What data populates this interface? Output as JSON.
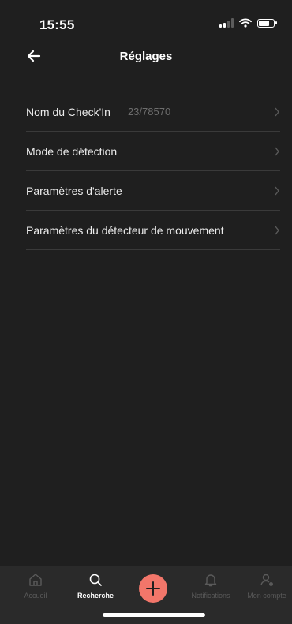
{
  "status_bar": {
    "time": "15:55"
  },
  "header": {
    "title": "Réglages"
  },
  "settings": {
    "items": [
      {
        "label": "Nom du Check'In",
        "value": "23/78570"
      },
      {
        "label": "Mode de détection"
      },
      {
        "label": "Paramètres d'alerte"
      },
      {
        "label": "Paramètres du détecteur de mouvement"
      }
    ]
  },
  "tab_bar": {
    "tabs": [
      {
        "label": "Accueil",
        "icon": "home-icon",
        "active": false
      },
      {
        "label": "Recherche",
        "icon": "search-icon",
        "active": true
      },
      {
        "label": "Notifications",
        "icon": "bell-icon",
        "active": false
      },
      {
        "label": "Mon compte",
        "icon": "user-icon",
        "active": false
      }
    ],
    "add_icon": "plus-icon"
  },
  "colors": {
    "background": "#1f1f1f",
    "tab_bar": "#2a2a2a",
    "accent": "#f2766a",
    "divider": "#3a3a3a"
  }
}
